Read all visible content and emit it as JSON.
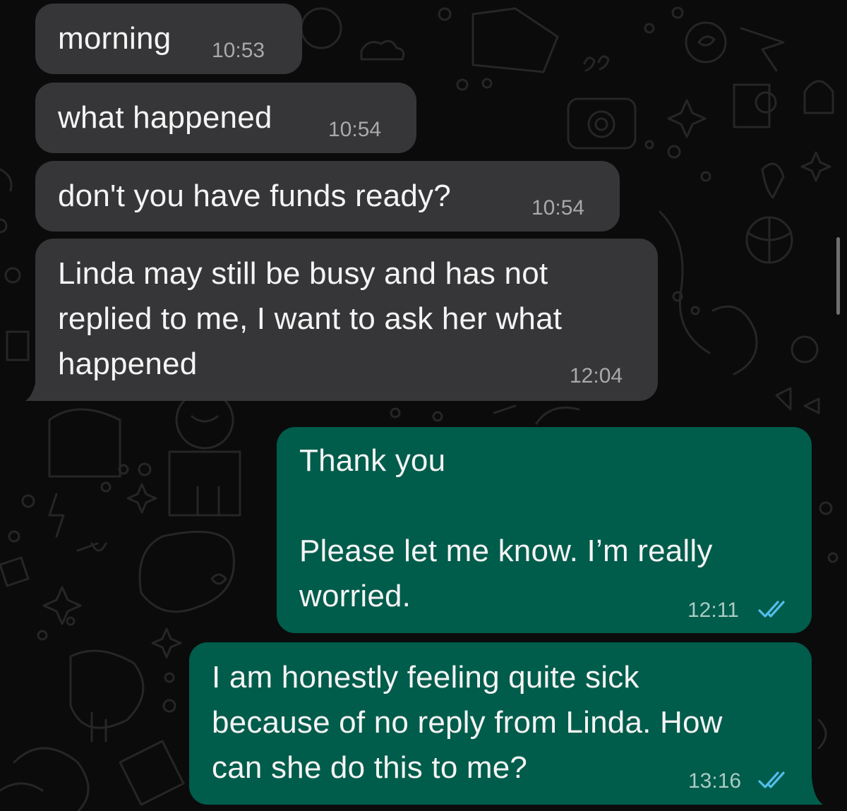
{
  "chat": {
    "messages": [
      {
        "direction": "incoming",
        "text": "morning",
        "time": "10:53"
      },
      {
        "direction": "incoming",
        "text": "what happened",
        "time": "10:54"
      },
      {
        "direction": "incoming",
        "text": "don't you have funds ready?",
        "time": "10:54"
      },
      {
        "direction": "incoming",
        "text": "Linda may still be busy and has not\nreplied to me, I want to ask her what\nhappened",
        "time": "12:04"
      },
      {
        "direction": "outgoing",
        "text": "Thank you\n\nPlease let me know. I’m really\nworried.",
        "time": "12:11",
        "status": "read"
      },
      {
        "direction": "outgoing",
        "text": "I am honestly feeling quite sick\nbecause of no reply from Linda. How\ncan she do this to me?",
        "time": "13:16",
        "status": "read"
      }
    ]
  },
  "colors": {
    "background": "#0b0b0b",
    "incoming_bubble": "#363638",
    "outgoing_bubble": "#005c4b",
    "read_ticks": "#53bdeb"
  },
  "icons": {
    "read_receipt": "double-check-icon",
    "wallpaper": "doodle-pattern"
  }
}
